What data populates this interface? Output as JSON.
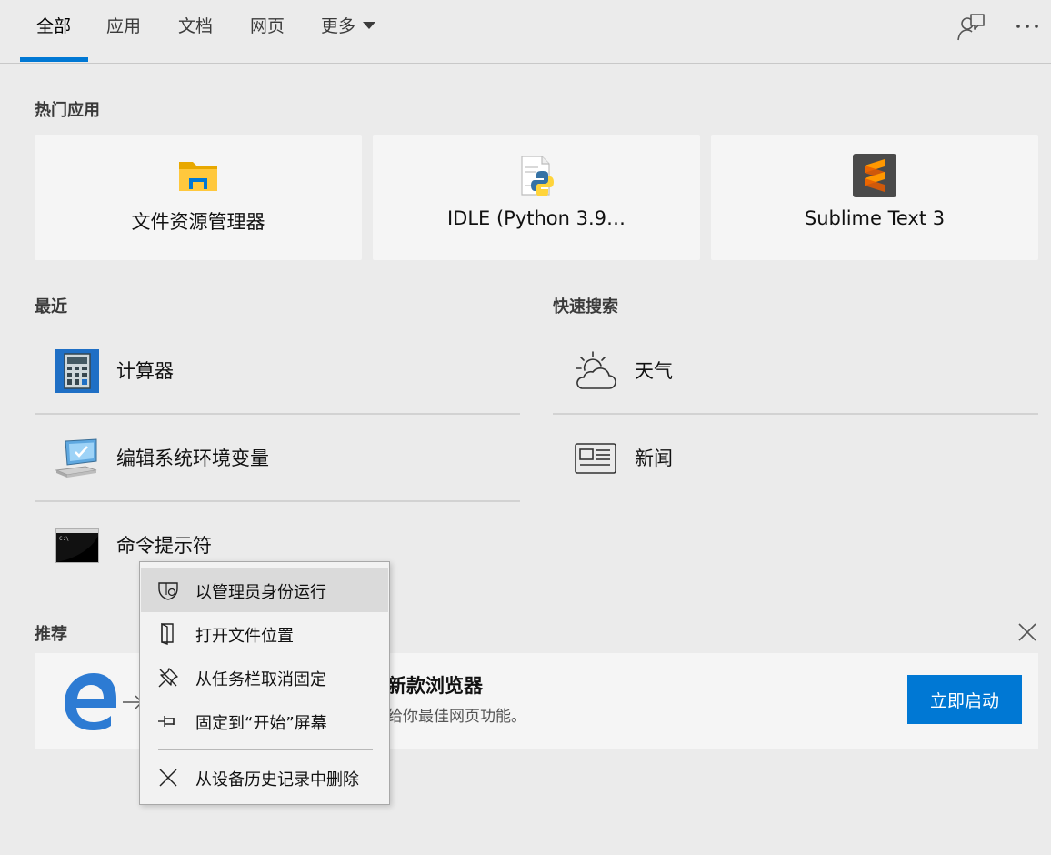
{
  "tabs": [
    {
      "label": "全部",
      "active": true
    },
    {
      "label": "应用"
    },
    {
      "label": "文档"
    },
    {
      "label": "网页"
    },
    {
      "label": "更多"
    }
  ],
  "top_icons": [
    "feedback-icon",
    "more-options-icon"
  ],
  "hot_apps": {
    "title": "热门应用",
    "items": [
      {
        "label": "文件资源管理器",
        "icon": "file-explorer-icon"
      },
      {
        "label": "IDLE (Python 3.9…",
        "icon": "python-idle-icon"
      },
      {
        "label": "Sublime Text 3",
        "icon": "sublime-text-icon"
      }
    ]
  },
  "recent": {
    "title": "最近",
    "items": [
      {
        "label": "计算器",
        "icon": "calculator-icon"
      },
      {
        "label": "编辑系统环境变量",
        "icon": "system-computer-icon"
      },
      {
        "label": "命令提示符",
        "icon": "command-prompt-icon"
      }
    ]
  },
  "quick_search": {
    "title": "快速搜索",
    "items": [
      {
        "label": "天气",
        "icon": "weather-icon"
      },
      {
        "label": "新闻",
        "icon": "news-icon"
      }
    ]
  },
  "recommend": {
    "title": "推荐",
    "banner_title": "新款浏览器",
    "banner_sub": "给你最佳网页功能。",
    "button_label": "立即启动"
  },
  "context_menu": {
    "items": [
      {
        "label": "以管理员身份运行",
        "icon": "shield-icon"
      },
      {
        "label": "打开文件位置",
        "icon": "file-location-icon"
      },
      {
        "label": "从任务栏取消固定",
        "icon": "unpin-icon"
      },
      {
        "label": "固定到“开始”屏幕",
        "icon": "pin-icon"
      },
      {
        "label": "从设备历史记录中删除",
        "icon": "close-icon"
      }
    ]
  },
  "colors": {
    "accent": "#0078d4",
    "background": "#ebebeb",
    "card": "#f5f5f5"
  }
}
